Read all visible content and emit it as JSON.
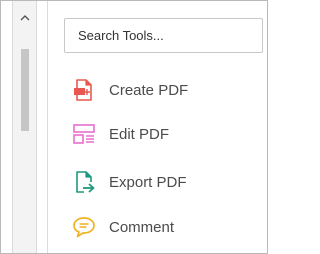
{
  "search": {
    "placeholder": "Search Tools..."
  },
  "tools": [
    {
      "label": "Create PDF",
      "icon": "create-pdf-icon",
      "color": "#e8584f"
    },
    {
      "label": "Edit PDF",
      "icon": "edit-pdf-icon",
      "color": "#e86fcf"
    },
    {
      "label": "Export PDF",
      "icon": "export-pdf-icon",
      "color": "#1c9a7e"
    },
    {
      "label": "Comment",
      "icon": "comment-icon",
      "color": "#f0b21f"
    }
  ],
  "colors": {
    "border": "#b9b9b9",
    "scrollbar_track": "#f3f3f3",
    "scrollbar_thumb": "#c6c6c6",
    "label_text": "#4b4b4b"
  }
}
